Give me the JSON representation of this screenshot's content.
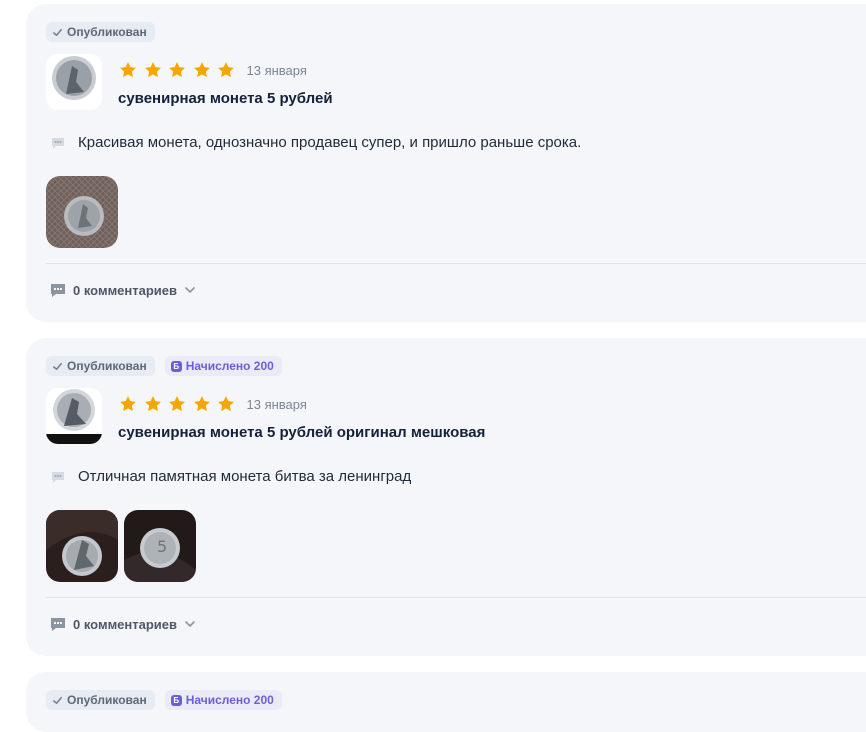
{
  "reviews": [
    {
      "status": "Опубликован",
      "points": "",
      "date": "13 января",
      "rating": 5,
      "title": "сувенирная монета 5 рублей",
      "text": "Красивая монета, однозначно продавец супер, и пришло раньше срока.",
      "photo_count": 1,
      "comments": "0 комментариев"
    },
    {
      "status": "Опубликован",
      "points": "Начислено 200",
      "date": "13 января",
      "rating": 5,
      "title": "сувенирная монета 5 рублей оригинал мешковая",
      "text": "Отличная памятная монета битва за ленинград",
      "photo_count": 2,
      "comments": "0 комментариев"
    },
    {
      "status": "Опубликован",
      "points": "Начислено 200"
    }
  ],
  "icons": {
    "check": "check-icon",
    "star": "star-icon",
    "bubble": "speech-bubble-icon",
    "chat": "chat-icon",
    "chevron": "chevron-down-icon",
    "bonus": "bonus-coin-icon"
  },
  "colors": {
    "star": "#f7a600",
    "card_bg": "#f4f6fa",
    "badge_points": "#6a5fd6",
    "bonus_letter": "Б"
  }
}
